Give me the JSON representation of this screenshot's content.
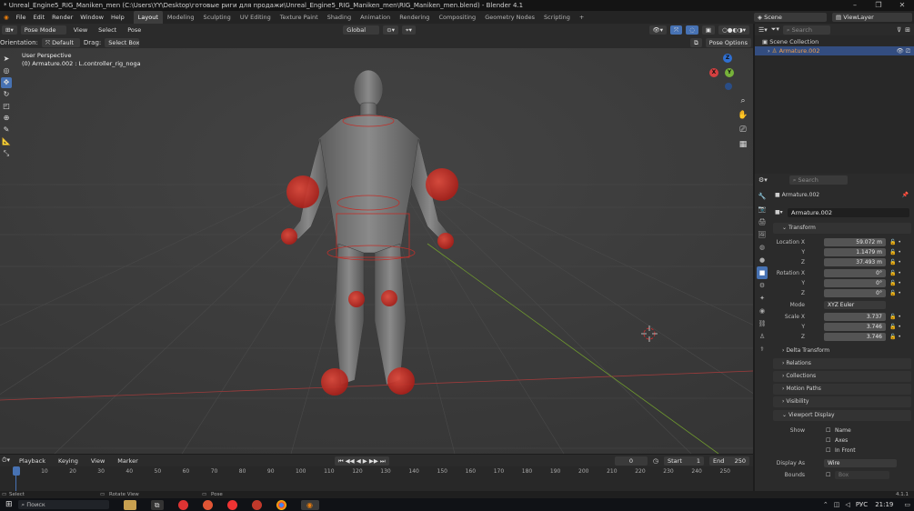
{
  "window": {
    "title": "* Unreal_Engine5_RIG_Maniken_men (C:\\Users\\YY\\Desktop\\готовые риги для продажи\\Unreal_Engine5_RIG_Maniken_men\\RIG_Maniken_men.blend) - Blender 4.1"
  },
  "menu": [
    "File",
    "Edit",
    "Render",
    "Window",
    "Help"
  ],
  "workspaces": [
    {
      "label": "Layout",
      "active": true
    },
    {
      "label": "Modeling"
    },
    {
      "label": "Sculpting"
    },
    {
      "label": "UV Editing"
    },
    {
      "label": "Texture Paint"
    },
    {
      "label": "Shading"
    },
    {
      "label": "Animation"
    },
    {
      "label": "Rendering"
    },
    {
      "label": "Compositing"
    },
    {
      "label": "Geometry Nodes"
    },
    {
      "label": "Scripting"
    }
  ],
  "scene": {
    "name": "Scene",
    "view_layer": "ViewLayer"
  },
  "viewport_header": {
    "mode": "Pose Mode",
    "menus": [
      "View",
      "Select",
      "Pose"
    ],
    "orientation_label": "Orientation:",
    "orientation": "Default",
    "drag_label": "Drag:",
    "drag": "Select Box",
    "transform_orientation": "Global",
    "pose_options": "Pose Options"
  },
  "viewport": {
    "perspective": "User Perspective",
    "active_object": "(0) Armature.002 : L.controller_rig_noga",
    "nav_axes": [
      "X",
      "Y",
      "Z"
    ],
    "colors": {
      "x_axis": "#9e3b3b",
      "y_axis": "#6f9a2e",
      "bone_sphere": "#d8352a",
      "active_tool": "#4772b3"
    }
  },
  "outliner": {
    "search_placeholder": "Search",
    "root": "Scene Collection",
    "items": [
      {
        "label": "Armature.002",
        "selected": true
      }
    ]
  },
  "properties": {
    "search_placeholder": "Search",
    "object_name": "Armature.002",
    "datablock": "Armature.002",
    "transform_title": "Transform",
    "location_label": "Location X",
    "location": [
      "59.072 m",
      "1.1479 m",
      "37.493 m"
    ],
    "rotation_label": "Rotation X",
    "rotation": [
      "0°",
      "0°",
      "0°"
    ],
    "mode_label": "Mode",
    "mode": "XYZ Euler",
    "scale_label": "Scale X",
    "scale": [
      "3.737",
      "3.746",
      "3.746"
    ],
    "axis_labels": [
      "Y",
      "Z"
    ],
    "delta_transform": "Delta Transform",
    "panels": [
      "Relations",
      "Collections",
      "Motion Paths",
      "Visibility"
    ],
    "viewport_display": {
      "title": "Viewport Display",
      "show_label": "Show",
      "name": "Name",
      "axes": "Axes",
      "in_front": "In Front",
      "display_as_label": "Display As",
      "display_as": "Wire",
      "bounds_label": "Bounds",
      "bounds": "Box"
    }
  },
  "timeline": {
    "menus": [
      "Playback",
      "Keying",
      "View",
      "Marker"
    ],
    "current_frame": "0",
    "start_label": "Start",
    "start": "1",
    "end_label": "End",
    "end": "250",
    "ticks": [
      "0",
      "10",
      "20",
      "30",
      "40",
      "50",
      "60",
      "70",
      "80",
      "90",
      "100",
      "110",
      "120",
      "130",
      "140",
      "150",
      "160",
      "170",
      "180",
      "190",
      "200",
      "210",
      "220",
      "230",
      "240",
      "250"
    ]
  },
  "statusbar": {
    "left": "Select",
    "middle": "Rotate View",
    "right": "Pose",
    "version": "4.1.1"
  },
  "taskbar": {
    "search": "Поиск",
    "lang": "РУС",
    "time": "21:19"
  }
}
